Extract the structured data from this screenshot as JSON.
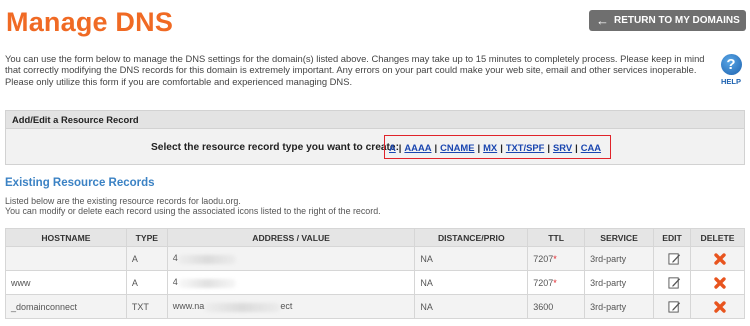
{
  "page_title": "Manage DNS",
  "return_button": {
    "label": "RETURN TO MY DOMAINS",
    "icon": "arrow-left-icon"
  },
  "intro": "You can use the form below to manage the DNS settings for the domain(s) listed above. Changes may take up to 15 minutes to completely process. Please keep in mind that correctly modifying the DNS records for this domain is extremely important. Any errors on your part could make your web site, email and other services inoperable. Please only utilize this form if you are comfortable and experienced managing DNS.",
  "help": {
    "label": "HELP",
    "symbol": "?",
    "icon": "help-icon"
  },
  "resource_panel": {
    "title": "Add/Edit a Resource Record",
    "prompt": "Select the resource record type you want to create:",
    "types": [
      "A",
      "AAAA",
      "CNAME",
      "MX",
      "TXT/SPF",
      "SRV",
      "CAA"
    ]
  },
  "existing": {
    "title": "Existing Resource Records",
    "desc_line1": "Listed below are the existing resource records for laodu.org.",
    "desc_line2": "You can modify or delete each record using the associated icons listed to the right of the record."
  },
  "table": {
    "headers": [
      "HOSTNAME",
      "TYPE",
      "ADDRESS / VALUE",
      "DISTANCE/PRIO",
      "TTL",
      "SERVICE",
      "EDIT",
      "DELETE"
    ],
    "rows": [
      {
        "hostname": "",
        "type": "A",
        "address": "4",
        "distance": "NA",
        "ttl": "7207",
        "ttl_mark": "*",
        "service": "3rd-party"
      },
      {
        "hostname": "www",
        "type": "A",
        "address": "4",
        "distance": "NA",
        "ttl": "7207",
        "ttl_mark": "*",
        "service": "3rd-party"
      },
      {
        "hostname": "_domainconnect",
        "type": "TXT",
        "address_prefix": "www.na",
        "address_suffix": "ect",
        "distance": "NA",
        "ttl": "3600",
        "ttl_mark": "",
        "service": "3rd-party"
      }
    ]
  },
  "colors": {
    "title_orange": "#f06a24",
    "link_blue": "#1a46b0",
    "section_blue": "#3b82c4",
    "highlight_red": "#e0232a",
    "delete_orange": "#e8541e"
  }
}
